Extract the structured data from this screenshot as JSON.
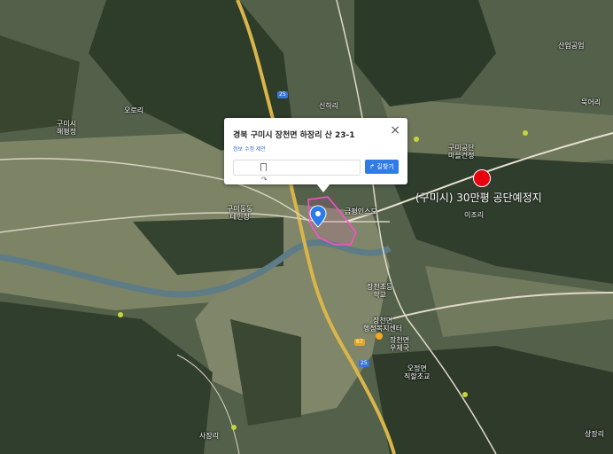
{
  "popup": {
    "address": "경북 구미시 장천면 하장리 산 23-1",
    "edit_link": "정보 수정 제안",
    "directions_label": "길찾기",
    "close_glyph": "×",
    "share_glyph": "↷"
  },
  "annotation": {
    "caption": "(구미시) 30만평  공단예정지",
    "dot_color": "#e8000f"
  },
  "place_labels": [
    {
      "text": "오로리",
      "name": "place-label-oro"
    },
    {
      "text": "구미시\n해평정",
      "name": "place-label-haepyeong"
    },
    {
      "text": "신하리",
      "name": "place-label-sinha"
    },
    {
      "text": "묵어리",
      "name": "place-label-mugeo"
    },
    {
      "text": "구미공단\n마을건정",
      "name": "place-label-village-1"
    },
    {
      "text": "이조리",
      "name": "place-label-ijo"
    },
    {
      "text": "구미동동\n테인정",
      "name": "place-label-village-2"
    },
    {
      "text": "금평인스모",
      "name": "place-label-geumpyeong"
    },
    {
      "text": "장천초등\n학교",
      "name": "place-label-school"
    },
    {
      "text": "장천면\n행정복지센터",
      "name": "place-label-office"
    },
    {
      "text": "장천면\n우체국",
      "name": "place-label-postoffice"
    },
    {
      "text": "오정면\n직할초교",
      "name": "place-label-ojeong"
    },
    {
      "text": "사장리",
      "name": "place-label-sajang"
    },
    {
      "text": "상장리",
      "name": "place-label-sangjang"
    },
    {
      "text": "산업공업",
      "name": "place-label-industry"
    }
  ],
  "road_shields": [
    {
      "text": "25",
      "name": "road-shield-25-north"
    },
    {
      "text": "25",
      "name": "road-shield-25-south"
    },
    {
      "text": "67",
      "name": "road-shield-67"
    }
  ],
  "colors": {
    "marker_blue": "#2b7be8",
    "parcel_outline": "#ff4fcf",
    "river": "#5e7c86"
  }
}
